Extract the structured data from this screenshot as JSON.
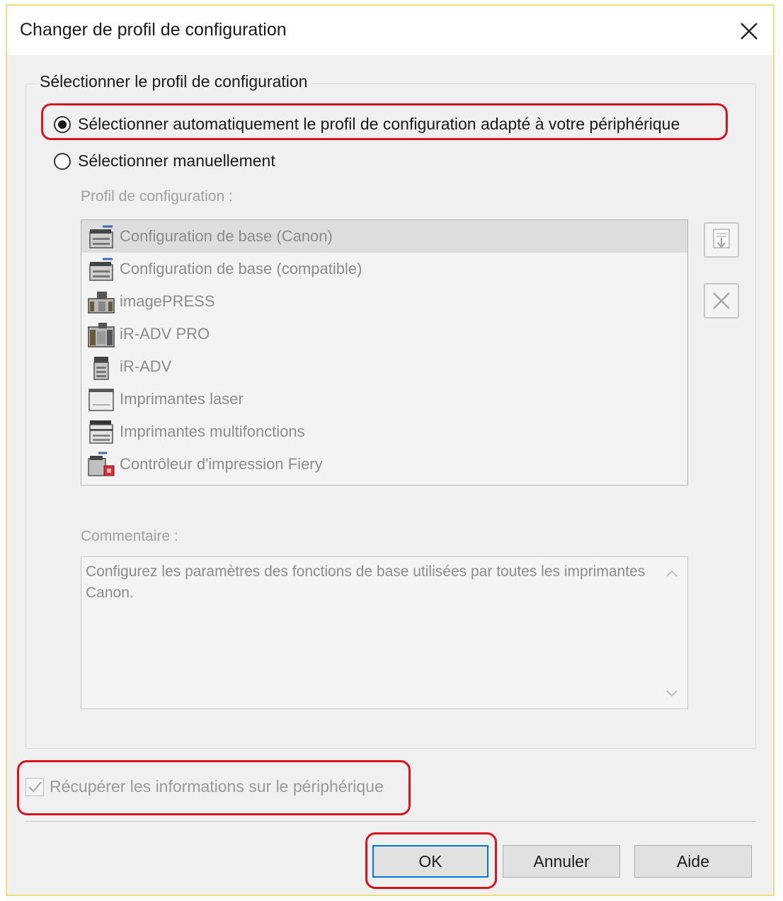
{
  "dialog": {
    "title": "Changer de profil de configuration"
  },
  "group": {
    "label": "Sélectionner le profil de configuration",
    "radio_auto": "Sélectionner automatiquement le profil de configuration adapté à votre périphérique",
    "radio_manual": "Sélectionner manuellement",
    "selected": "auto"
  },
  "profile_list": {
    "label": "Profil de configuration :",
    "items": [
      {
        "label": "Configuration de base (Canon)",
        "icon": "printer-icon"
      },
      {
        "label": "Configuration de base (compatible)",
        "icon": "printer-icon"
      },
      {
        "label": "imagePRESS",
        "icon": "production-press-icon"
      },
      {
        "label": "iR-ADV PRO",
        "icon": "production-press-icon"
      },
      {
        "label": "iR-ADV",
        "icon": "copier-icon"
      },
      {
        "label": "Imprimantes laser",
        "icon": "laser-printer-icon"
      },
      {
        "label": "Imprimantes multifonctions",
        "icon": "multifunction-printer-icon"
      },
      {
        "label": "Contrôleur d'impression Fiery",
        "icon": "fiery-controller-icon"
      }
    ],
    "selected_index": 0
  },
  "comment": {
    "label": "Commentaire :",
    "text": "Configurez les paramètres des fonctions de base utilisées par toutes les imprimantes Canon."
  },
  "retrieve_info": {
    "label": "Récupérer les informations sur le périphérique",
    "checked": true
  },
  "buttons": {
    "ok": "OK",
    "cancel": "Annuler",
    "help": "Aide"
  },
  "colors": {
    "highlight": "#d8141e",
    "default_button_border": "#0078d7"
  }
}
